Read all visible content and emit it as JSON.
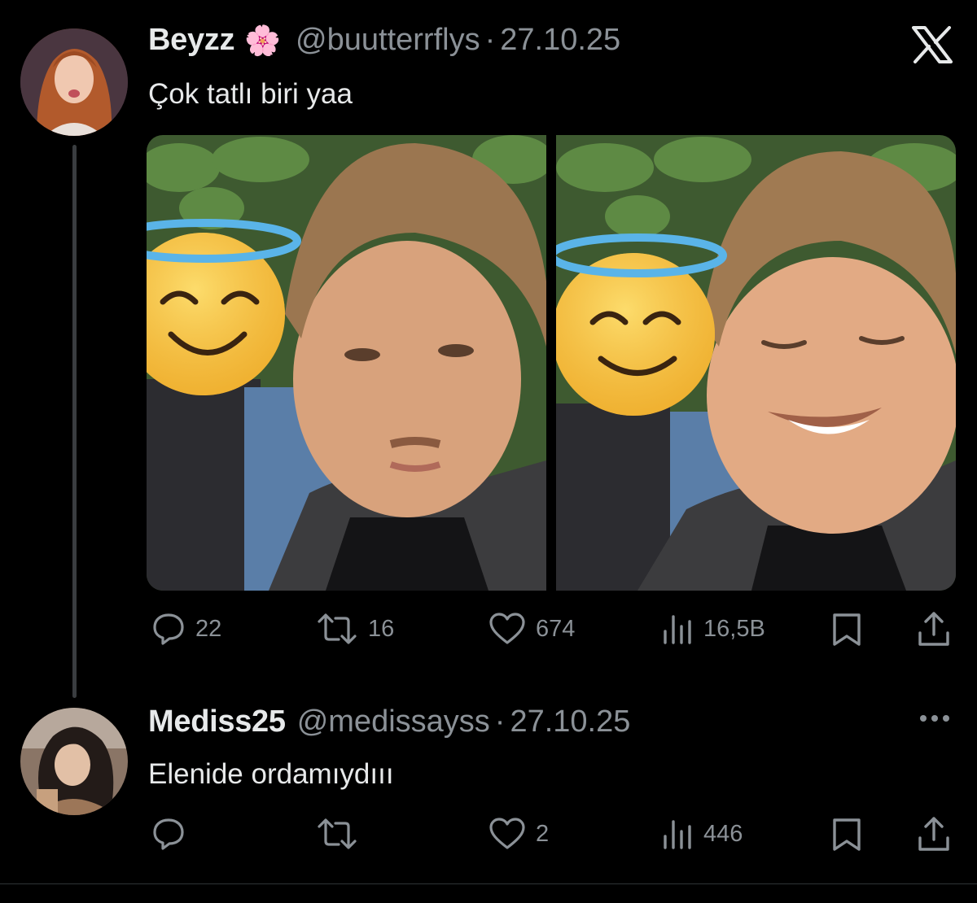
{
  "tweet": {
    "display_name": "Beyzz",
    "name_emoji": "🌸",
    "handle": "@buutterrflys",
    "separator": "·",
    "date": "27.10.25",
    "text": "Çok tatlı biri yaa",
    "actions": {
      "replies": "22",
      "retweets": "16",
      "likes": "674",
      "views": "16,5B"
    }
  },
  "reply": {
    "display_name": "Mediss25",
    "handle": "@medissayss",
    "separator": "·",
    "date": "27.10.25",
    "text": "Elenide ordamıydııı",
    "actions": {
      "replies": "",
      "retweets": "",
      "likes": "2",
      "views": "446"
    }
  },
  "icons": {
    "platform": "x-logo-icon",
    "more": "more-horizontal-icon",
    "reply": "reply-icon",
    "retweet": "retweet-icon",
    "like": "heart-icon",
    "views": "views-icon",
    "bookmark": "bookmark-icon",
    "share": "share-icon"
  },
  "colors": {
    "background": "#000000",
    "text": "#e7e9ea",
    "muted": "#8b9197",
    "thread_line": "#3a3d40"
  }
}
